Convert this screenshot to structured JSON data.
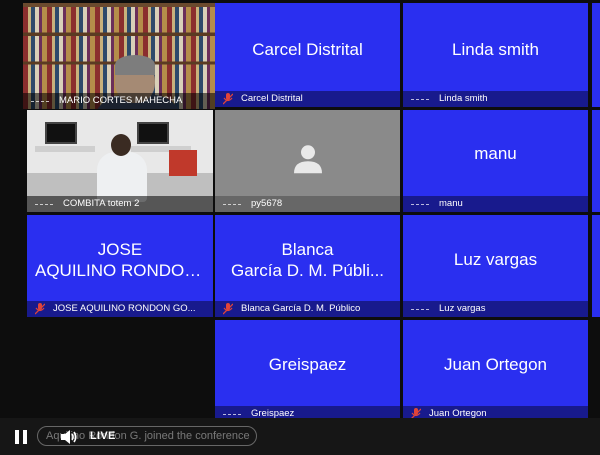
{
  "tiles": [
    {
      "id": "mario",
      "type": "video",
      "label": "MARIO CORTES MAHECHA",
      "active": true,
      "muted": false
    },
    {
      "id": "carcel",
      "type": "name",
      "name_lines": [
        "Carcel Distrital"
      ],
      "label": "Carcel Distrital",
      "muted": true
    },
    {
      "id": "linda",
      "type": "name",
      "name_lines": [
        "Linda smith"
      ],
      "label": "Linda smith",
      "muted": false
    },
    {
      "id": "combita",
      "type": "video",
      "label": "COMBITA totem 2",
      "muted": false
    },
    {
      "id": "py",
      "type": "avatar",
      "label": "py5678",
      "muted": false
    },
    {
      "id": "manu",
      "type": "name",
      "name_lines": [
        "manu"
      ],
      "label": "manu",
      "muted": false
    },
    {
      "id": "jose",
      "type": "name",
      "name_lines": [
        "JOSE",
        "AQUILINO RONDON ..."
      ],
      "label": "JOSE AQUILINO RONDON GO...",
      "muted": true
    },
    {
      "id": "blanca",
      "type": "name",
      "name_lines": [
        "Blanca",
        "García D. M.   Públi..."
      ],
      "label": "Blanca García D. M.   Público",
      "muted": true
    },
    {
      "id": "luz",
      "type": "name",
      "name_lines": [
        "Luz vargas"
      ],
      "label": "Luz vargas",
      "muted": false
    },
    {
      "id": "greis",
      "type": "name",
      "name_lines": [
        "Greispaez"
      ],
      "label": "Greispaez",
      "muted": false
    },
    {
      "id": "juan",
      "type": "name",
      "name_lines": [
        "Juan Ortegon"
      ],
      "label": "Juan Ortegon",
      "muted": true
    }
  ],
  "controls": {
    "live_label": "LIVE",
    "notification": "Aquilino Rondon G. joined the conference"
  },
  "colors": {
    "tile_blue": "#2a2ff0",
    "active_border": "#f5d64b",
    "mute_red": "#e0453a"
  },
  "icons": {
    "pause": "pause-icon",
    "volume": "volume-icon",
    "muted": "microphone-off-icon",
    "signal": "signal-icon",
    "avatar": "user-avatar-icon"
  }
}
